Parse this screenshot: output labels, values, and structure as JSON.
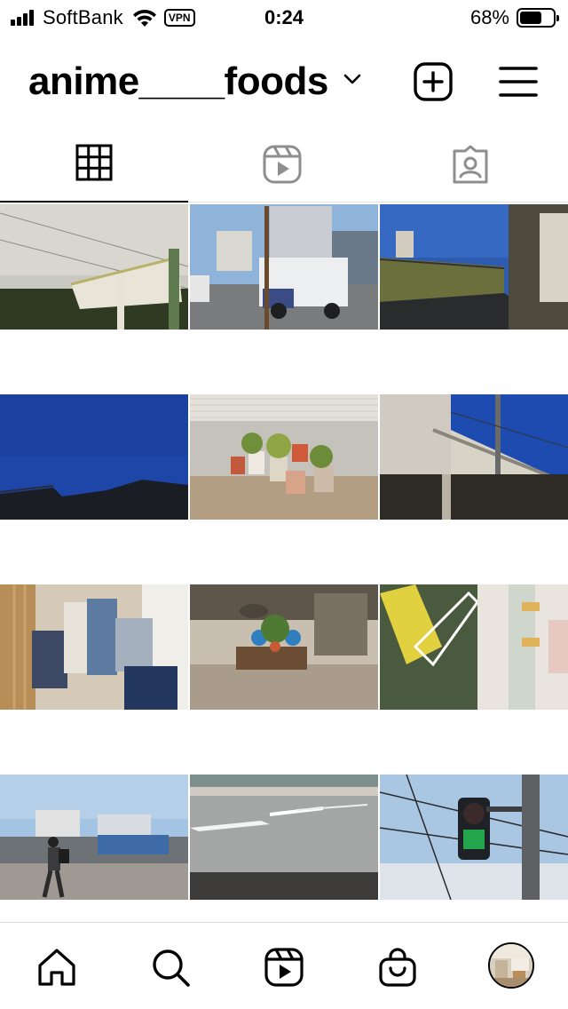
{
  "status_bar": {
    "carrier": "SoftBank",
    "vpn": "VPN",
    "time": "0:24",
    "battery_percent": "68%",
    "battery_level": 0.68
  },
  "header": {
    "profile_name": "anime____foods"
  },
  "tabs": [
    {
      "name": "posts",
      "icon": "grid-icon",
      "active": true
    },
    {
      "name": "reels",
      "icon": "reels-icon",
      "active": false
    },
    {
      "name": "tagged",
      "icon": "tagged-icon",
      "active": false
    }
  ],
  "posts": [
    {
      "subject": "white overpass stairs, cloudy sky"
    },
    {
      "subject": "utility truck at street intersection"
    },
    {
      "subject": "railway embankment road, blue sky"
    },
    {
      "subject": "deep blue evening sky over rooftops"
    },
    {
      "subject": "flower pots against garage wall"
    },
    {
      "subject": "elevated train station platform"
    },
    {
      "subject": "hanging photo prints display"
    },
    {
      "subject": "potted plants on wooden pallet"
    },
    {
      "subject": "yellow shopping basket close-up"
    },
    {
      "subject": "pedestrian walking on street"
    },
    {
      "subject": "empty parking lot asphalt"
    },
    {
      "subject": "green pedestrian traffic signal"
    }
  ],
  "bottom_nav": [
    {
      "name": "home",
      "icon": "home-icon"
    },
    {
      "name": "search",
      "icon": "search-icon"
    },
    {
      "name": "reels",
      "icon": "reels-icon"
    },
    {
      "name": "shop",
      "icon": "shopping-bag-icon"
    },
    {
      "name": "profile",
      "icon": "avatar"
    }
  ],
  "colors": {
    "accent": "#000000",
    "background": "#ffffff",
    "divider": "#dbdbdb"
  }
}
